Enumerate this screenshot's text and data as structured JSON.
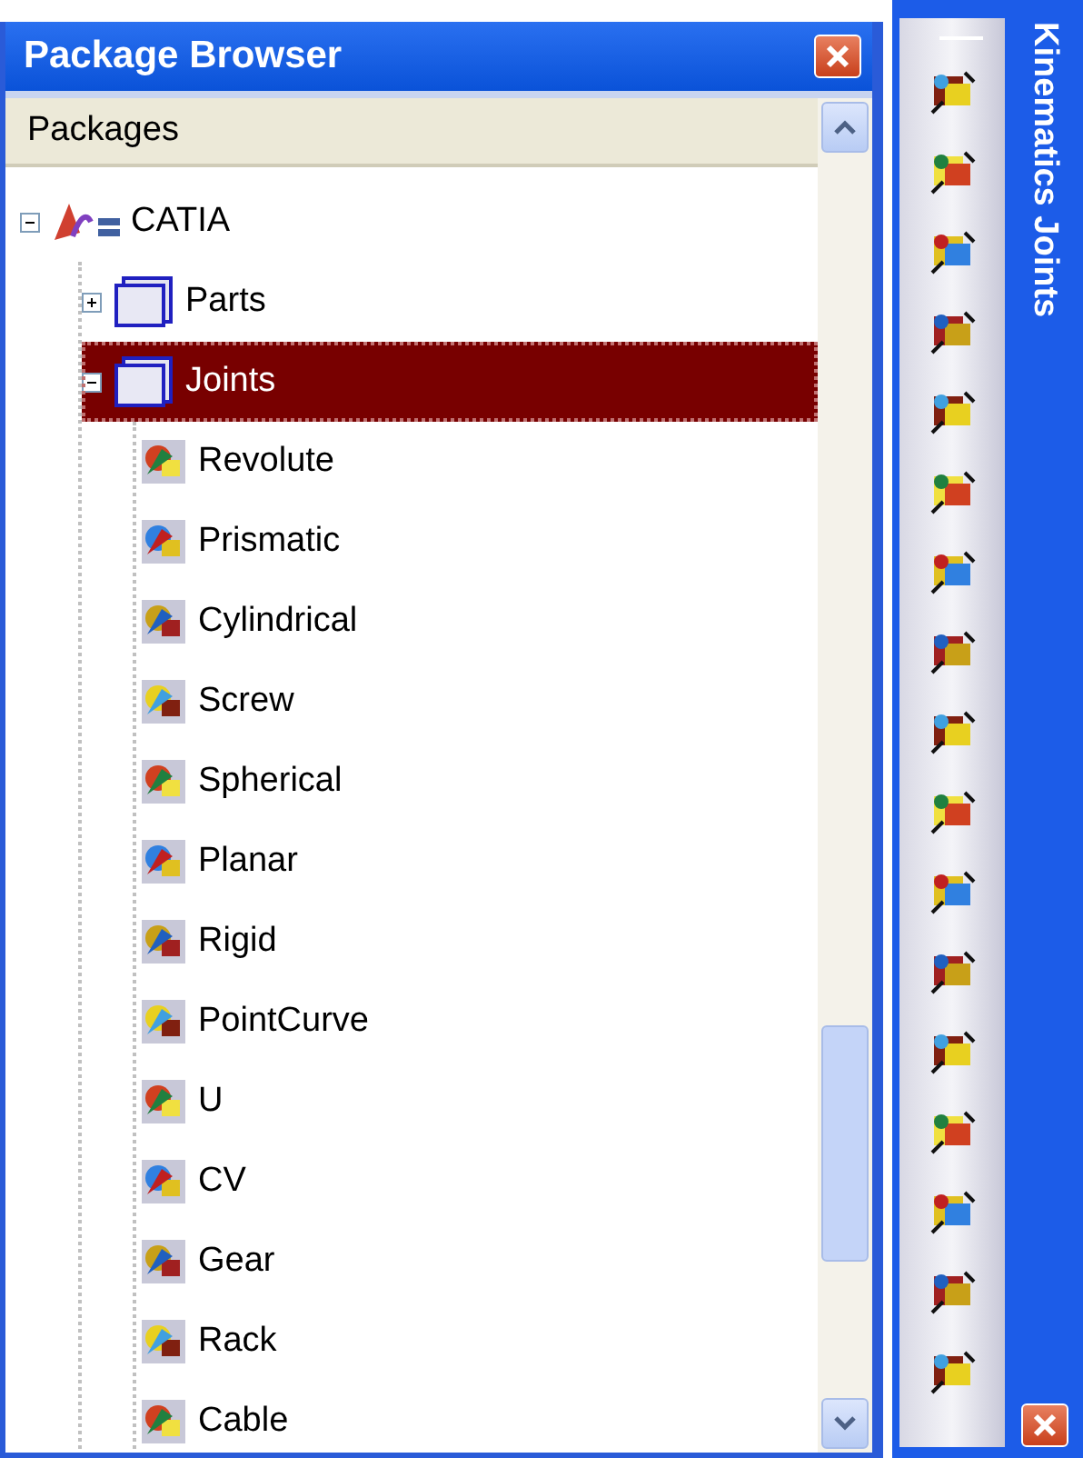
{
  "window": {
    "title": "Package Browser"
  },
  "header": "Packages",
  "tree": [
    {
      "label": "CATIA",
      "kind": "root",
      "expanded": true,
      "selected": false,
      "children": [
        {
          "label": "Parts",
          "kind": "folder",
          "expanded": false,
          "selected": false
        },
        {
          "label": "Joints",
          "kind": "folder",
          "expanded": true,
          "selected": true,
          "children": [
            {
              "label": "Revolute",
              "kind": "joint",
              "selected": false
            },
            {
              "label": "Prismatic",
              "kind": "joint",
              "selected": false
            },
            {
              "label": "Cylindrical",
              "kind": "joint",
              "selected": false
            },
            {
              "label": "Screw",
              "kind": "joint",
              "selected": false
            },
            {
              "label": "Spherical",
              "kind": "joint",
              "selected": false
            },
            {
              "label": "Planar",
              "kind": "joint",
              "selected": false
            },
            {
              "label": "Rigid",
              "kind": "joint",
              "selected": false
            },
            {
              "label": "PointCurve",
              "kind": "joint",
              "selected": false
            },
            {
              "label": "U",
              "kind": "joint",
              "selected": false
            },
            {
              "label": "CV",
              "kind": "joint",
              "selected": false
            },
            {
              "label": "Gear",
              "kind": "joint",
              "selected": false
            },
            {
              "label": "Rack",
              "kind": "joint",
              "selected": false
            },
            {
              "label": "Cable",
              "kind": "joint",
              "selected": false
            }
          ]
        }
      ]
    }
  ],
  "toolbar": {
    "title": "Kinematics Joints"
  }
}
